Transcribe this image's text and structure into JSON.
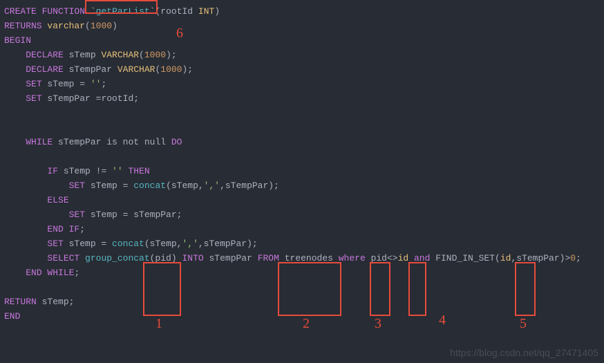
{
  "code": {
    "l1_create": "CREATE",
    "l1_function": "FUNCTION",
    "l1_tick1": "`",
    "l1_name": "getParList",
    "l1_tick2": "`",
    "l1_paren1": "(rootId ",
    "l1_int": "INT",
    "l1_paren2": ")",
    "l2_returns": "RETURNS",
    "l2_varchar": "varchar",
    "l2_open": "(",
    "l2_num": "1000",
    "l2_close": ")",
    "l3": "BEGIN",
    "l4_declare": "DECLARE",
    "l4_var": " sTemp ",
    "l4_type": "VARCHAR",
    "l4_open": "(",
    "l4_num": "1000",
    "l4_close": ");",
    "l5_declare": "DECLARE",
    "l5_var": " sTempPar ",
    "l5_type": "VARCHAR",
    "l5_open": "(",
    "l5_num": "1000",
    "l5_close": ");",
    "l6_set": "SET",
    "l6_rest": " sTemp = ",
    "l6_str": "''",
    "l6_semi": ";",
    "l7_set": "SET",
    "l7_rest": " sTempPar =rootId;",
    "l8_while": "WHILE",
    "l8_mid": " sTempPar is not null ",
    "l8_do": "DO",
    "l9_if": "IF",
    "l9_mid": " sTemp != ",
    "l9_str": "''",
    "l9_then": " THEN",
    "l10_set": "SET",
    "l10_mid": " sTemp = ",
    "l10_func": "concat",
    "l10_open": "(sTemp,",
    "l10_str": "','",
    "l10_close": ",sTempPar);",
    "l11": "ELSE",
    "l12_set": "SET",
    "l12_rest": " sTemp = sTempPar;",
    "l13_end": "END",
    "l13_if": " IF",
    "l13_semi": ";",
    "l14_set": "SET",
    "l14_mid": " sTemp = ",
    "l14_func": "concat",
    "l14_open": "(sTemp,",
    "l14_str": "','",
    "l14_close": ",sTempPar);",
    "l15_select": "SELECT",
    "l15_func": " group_concat",
    "l15_pid": "(pid) ",
    "l15_into": "INTO",
    "l15_var": " sTempPar ",
    "l15_from": "FROM",
    "l15_tbl": " treenodes ",
    "l15_where": "where",
    "l15_cond1": " pid<>",
    "l15_id1": "id",
    "l15_and": " and",
    "l15_fis": " FIND_IN_SET(",
    "l15_id2": "id",
    "l15_tail": ",sTempPar)>",
    "l15_zero": "0",
    "l15_semi": ";",
    "l16_end": "END",
    "l16_while": " WHILE",
    "l16_semi": ";",
    "l17_return": "RETURN",
    "l17_var": " sTemp;",
    "l18": "END"
  },
  "labels": {
    "n1": "1",
    "n2": "2",
    "n3": "3",
    "n4": "4",
    "n5": "5",
    "n6": "6"
  },
  "watermark": "https://blog.csdn.net/qq_27471405"
}
